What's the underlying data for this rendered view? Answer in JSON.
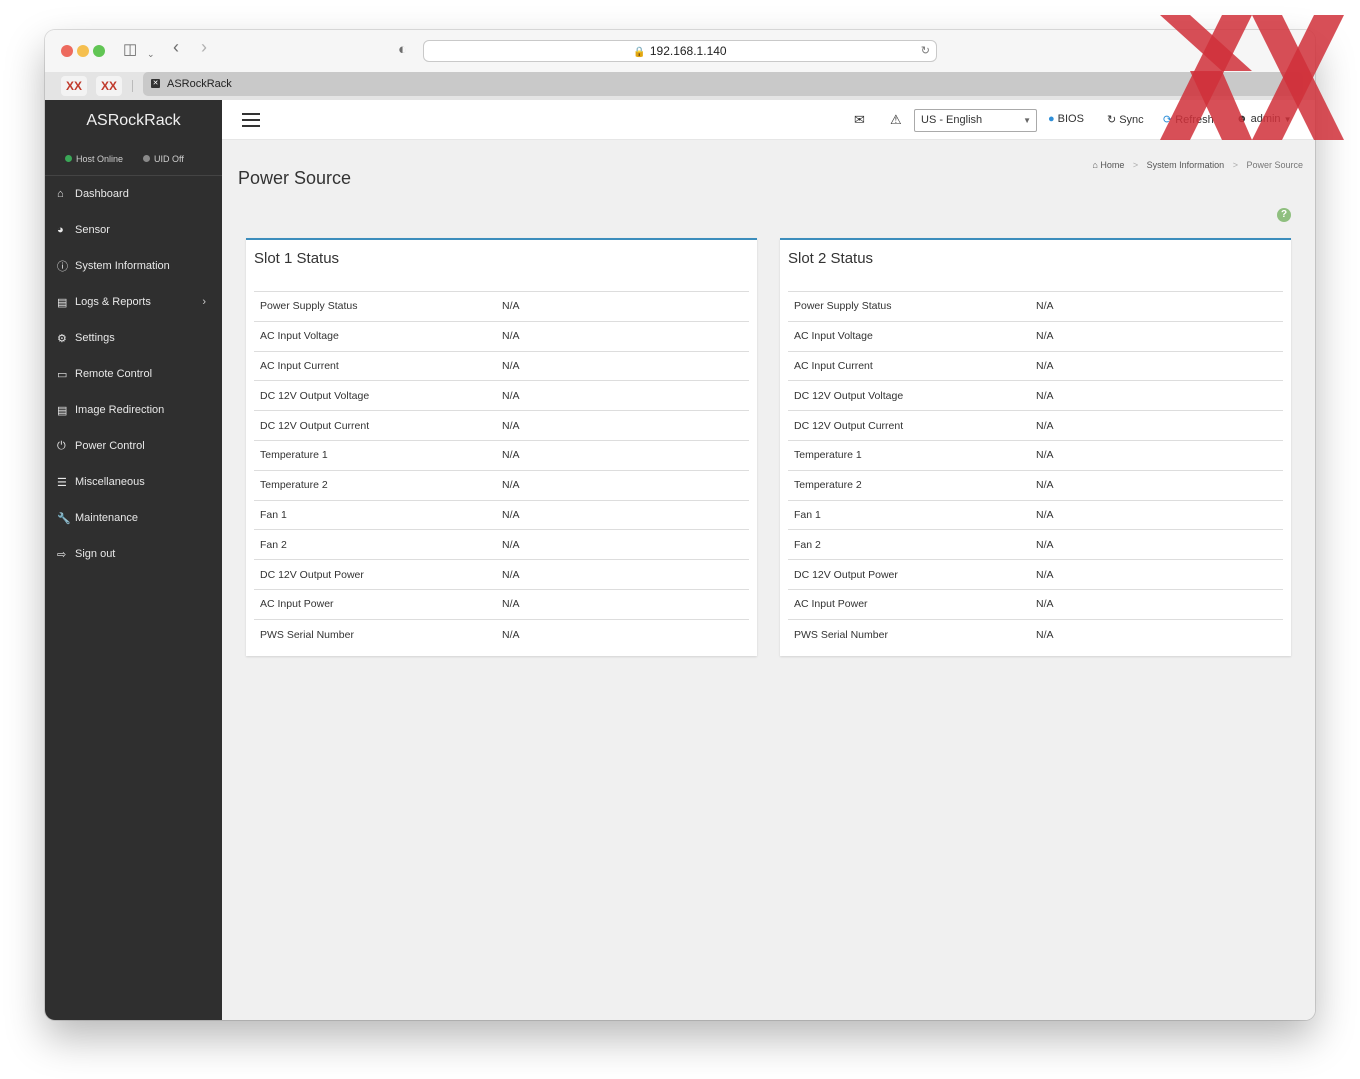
{
  "browser": {
    "url": "192.168.1.140",
    "tab_title": "ASRockRack",
    "pinned_tabs": [
      "XX",
      "XX"
    ]
  },
  "sidebar": {
    "brand": "ASRockRack",
    "status": [
      {
        "label": "Host Online",
        "color": "#3aa757"
      },
      {
        "label": "UID Off",
        "color": "#8a8a8a"
      }
    ],
    "items": [
      {
        "label": "Dashboard",
        "icon": "home-icon"
      },
      {
        "label": "Sensor",
        "icon": "gauge-icon"
      },
      {
        "label": "System Information",
        "icon": "info-icon"
      },
      {
        "label": "Logs & Reports",
        "icon": "chart-icon"
      },
      {
        "label": "Settings",
        "icon": "gear-icon"
      },
      {
        "label": "Remote Control",
        "icon": "monitor-icon"
      },
      {
        "label": "Image Redirection",
        "icon": "drive-icon"
      },
      {
        "label": "Power Control",
        "icon": "power-icon"
      },
      {
        "label": "Miscellaneous",
        "icon": "list-icon"
      },
      {
        "label": "Maintenance",
        "icon": "wrench-icon"
      },
      {
        "label": "Sign out",
        "icon": "signout-icon"
      }
    ]
  },
  "topnav": {
    "language": "US - English",
    "bios": "BIOS",
    "sync": "Sync",
    "refresh": "Refresh",
    "user": "admin"
  },
  "page": {
    "title": "Power Source",
    "breadcrumb": [
      "Home",
      "System Information",
      "Power Source"
    ]
  },
  "panels": [
    {
      "title": "Slot 1 Status",
      "rows": [
        {
          "label": "Power Supply Status",
          "value": "N/A"
        },
        {
          "label": "AC Input Voltage",
          "value": "N/A"
        },
        {
          "label": "AC Input Current",
          "value": "N/A"
        },
        {
          "label": "DC 12V Output Voltage",
          "value": "N/A"
        },
        {
          "label": "DC 12V Output Current",
          "value": "N/A"
        },
        {
          "label": "Temperature 1",
          "value": "N/A"
        },
        {
          "label": "Temperature 2",
          "value": "N/A"
        },
        {
          "label": "Fan 1",
          "value": "N/A"
        },
        {
          "label": "Fan 2",
          "value": "N/A"
        },
        {
          "label": "DC 12V Output Power",
          "value": "N/A"
        },
        {
          "label": "AC Input Power",
          "value": "N/A"
        },
        {
          "label": "PWS Serial Number",
          "value": "N/A"
        }
      ]
    },
    {
      "title": "Slot 2 Status",
      "rows": [
        {
          "label": "Power Supply Status",
          "value": "N/A"
        },
        {
          "label": "AC Input Voltage",
          "value": "N/A"
        },
        {
          "label": "AC Input Current",
          "value": "N/A"
        },
        {
          "label": "DC 12V Output Voltage",
          "value": "N/A"
        },
        {
          "label": "DC 12V Output Current",
          "value": "N/A"
        },
        {
          "label": "Temperature 1",
          "value": "N/A"
        },
        {
          "label": "Temperature 2",
          "value": "N/A"
        },
        {
          "label": "Fan 1",
          "value": "N/A"
        },
        {
          "label": "Fan 2",
          "value": "N/A"
        },
        {
          "label": "DC 12V Output Power",
          "value": "N/A"
        },
        {
          "label": "AC Input Power",
          "value": "N/A"
        },
        {
          "label": "PWS Serial Number",
          "value": "N/A"
        }
      ]
    }
  ],
  "colors": {
    "sidebar_bg": "#2f2f2f",
    "panel_accent": "#3c8dbc",
    "refresh_icon": "#2f8fd8",
    "bios_icon": "#2f8fd8",
    "help_icon": "#8fbf7f",
    "watermark": "#d0303a"
  }
}
